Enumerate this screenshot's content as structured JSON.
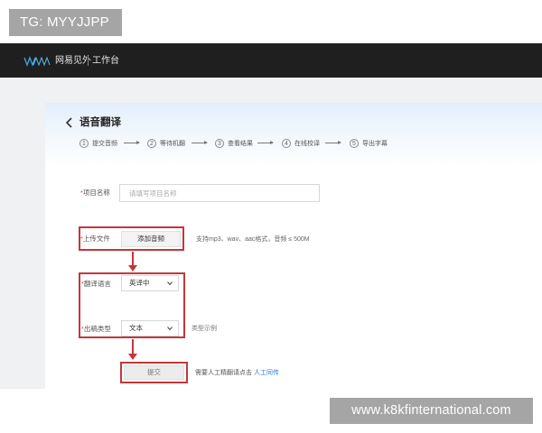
{
  "overlay_tag": "TG: MYYJJPP",
  "header": {
    "brand": "网易见外",
    "workspace": "工作台"
  },
  "page": {
    "title": "语音翻译"
  },
  "steps": [
    {
      "num": "1",
      "label": "提交音频"
    },
    {
      "num": "2",
      "label": "等待机翻"
    },
    {
      "num": "3",
      "label": "查看结果"
    },
    {
      "num": "4",
      "label": "在线校译"
    },
    {
      "num": "5",
      "label": "导出字幕"
    }
  ],
  "form": {
    "required_mark": "*",
    "name": {
      "label": "项目名称",
      "placeholder": "请填写项目名称"
    },
    "upload": {
      "label": "上传文件",
      "button": "添加音频",
      "hint": "支持mp3、wav、aac格式，音频 ≤ 500M"
    },
    "language": {
      "label": "翻译语言",
      "value": "英译中"
    },
    "output": {
      "label": "出稿类型",
      "value": "文本",
      "hint": "类型示例"
    },
    "submit": {
      "button": "提交",
      "hint": "需要人工精翻请点击",
      "link": "人工同传"
    }
  },
  "colors": {
    "highlight": "#c2373a",
    "header_bg": "#1f1f20",
    "link": "#2f7bd9"
  },
  "watermark": "www.k8kfinternational.com"
}
